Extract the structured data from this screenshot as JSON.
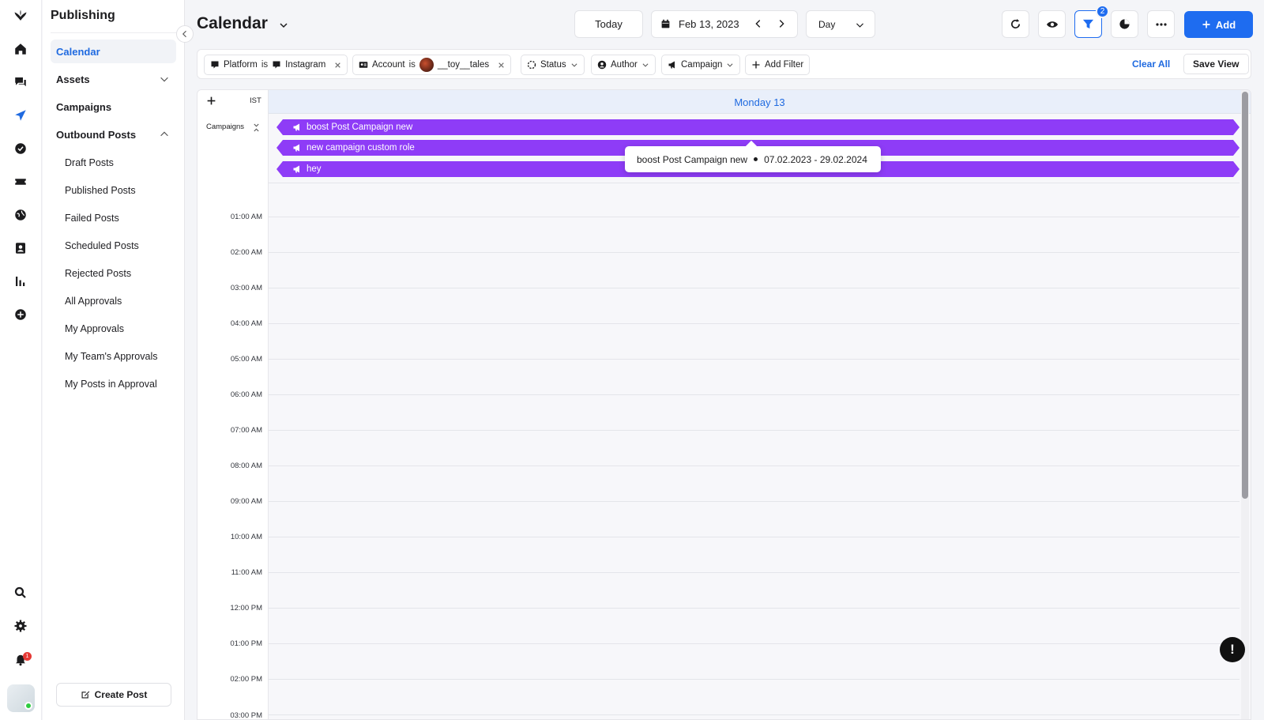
{
  "app": {
    "section_title": "Publishing",
    "page_title": "Calendar"
  },
  "rail": {
    "icons": [
      "logo-icon",
      "home-icon",
      "chat-icon",
      "send-icon",
      "check-circle-icon",
      "ticket-icon",
      "globe-icon",
      "contact-book-icon",
      "bar-chart-icon",
      "plus-circle-icon",
      "search-icon",
      "gear-icon",
      "bell-icon"
    ],
    "notification_count": "1"
  },
  "sidebar": {
    "items": [
      {
        "label": "Calendar",
        "active": true
      },
      {
        "label": "Assets"
      },
      {
        "label": "Campaigns"
      },
      {
        "label": "Outbound Posts"
      }
    ],
    "subitems": [
      "Draft Posts",
      "Published Posts",
      "Failed Posts",
      "Scheduled Posts",
      "Rejected Posts",
      "All Approvals",
      "My Approvals",
      "My Team's Approvals",
      "My Posts in Approval"
    ],
    "create_post": "Create Post"
  },
  "toolbar": {
    "today": "Today",
    "date": "Feb 13, 2023",
    "view": "Day",
    "filter_count": "2",
    "add": "Add"
  },
  "filters": {
    "platform_label": "Platform",
    "platform_op": "is",
    "platform_value": "Instagram",
    "account_label": "Account",
    "account_op": "is",
    "account_value": "__toy__tales",
    "status": "Status",
    "author": "Author",
    "campaign": "Campaign",
    "add_filter": "Add Filter",
    "clear_all": "Clear All",
    "save_view": "Save View"
  },
  "calendar": {
    "timezone": "IST",
    "campaigns_label": "Campaigns",
    "day_label": "Monday 13",
    "campaigns": [
      "boost Post Campaign new",
      "new campaign custom role",
      "hey"
    ],
    "hours": [
      "01:00 AM",
      "02:00 AM",
      "03:00 AM",
      "04:00 AM",
      "05:00 AM",
      "06:00 AM",
      "07:00 AM",
      "08:00 AM",
      "09:00 AM",
      "10:00 AM",
      "11:00 AM",
      "12:00 PM",
      "01:00 PM",
      "02:00 PM",
      "03:00 PM"
    ],
    "tooltip_name": "boost Post Campaign new",
    "tooltip_range": "07.02.2023 - 29.02.2024",
    "campaign_color": "#8e3cf7"
  },
  "colors": {
    "accent": "#1e6cf0",
    "active_text": "#1f6ae0"
  }
}
